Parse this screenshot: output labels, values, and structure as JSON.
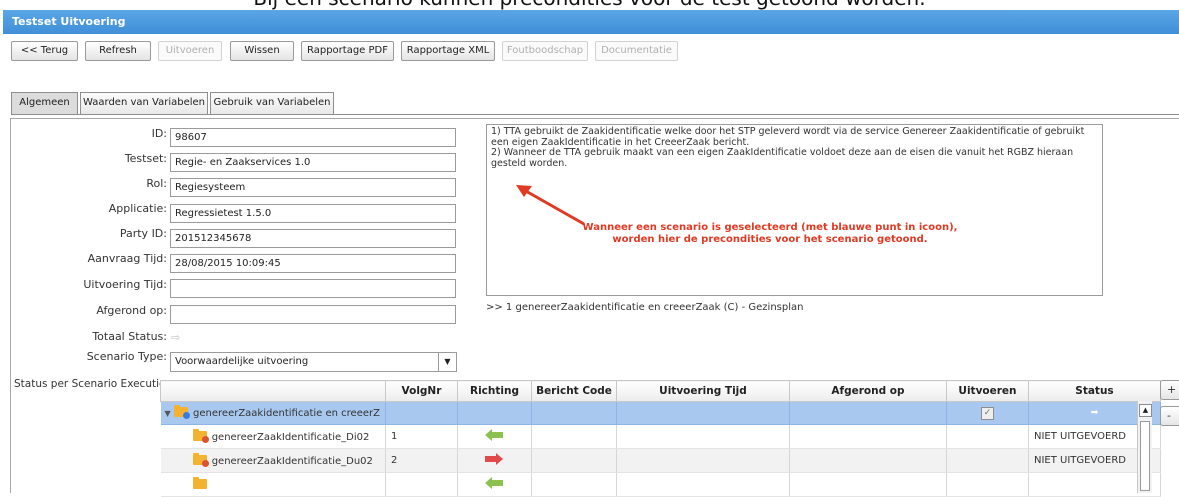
{
  "caption": "Bij een scenario kunnen precondities voor de test getoond worden.",
  "window": {
    "title": "Testset Uitvoering"
  },
  "toolbar": [
    {
      "label": "<< Terug",
      "enabled": true
    },
    {
      "label": "Refresh",
      "enabled": true
    },
    {
      "label": "Uitvoeren",
      "enabled": false
    },
    {
      "label": "Wissen",
      "enabled": true
    },
    {
      "label": "Rapportage PDF",
      "enabled": true
    },
    {
      "label": "Rapportage XML",
      "enabled": true
    },
    {
      "label": "Foutboodschap",
      "enabled": false
    },
    {
      "label": "Documentatie",
      "enabled": false
    }
  ],
  "tabs": [
    {
      "label": "Algemeen",
      "active": true
    },
    {
      "label": "Waarden van Variabelen",
      "active": false
    },
    {
      "label": "Gebruik van Variabelen",
      "active": false
    }
  ],
  "form": {
    "id": {
      "label": "ID:",
      "value": "98607"
    },
    "testset": {
      "label": "Testset:",
      "value": "Regie- en Zaakservices 1.0"
    },
    "rol": {
      "label": "Rol:",
      "value": "Regiesysteem"
    },
    "applicatie": {
      "label": "Applicatie:",
      "value": "Regressietest 1.5.0"
    },
    "party_id": {
      "label": "Party ID:",
      "value": "201512345678"
    },
    "aanvraag_tijd": {
      "label": "Aanvraag Tijd:",
      "value": "28/08/2015 10:09:45"
    },
    "uitvoering_tijd": {
      "label": "Uitvoering Tijd:",
      "value": ""
    },
    "afgerond_op": {
      "label": "Afgerond op:",
      "value": ""
    },
    "totaal_status": {
      "label": "Totaal Status:",
      "icon": "arrow-right-outline-icon"
    },
    "scenario_type": {
      "label": "Scenario Type:",
      "value": "Voorwaardelijke uitvoering"
    },
    "status_per_scenario": {
      "label": "Status per Scenario Executie:"
    }
  },
  "preconditions": {
    "line1": "1) TTA gebruikt de Zaakidentificatie welke door het STP geleverd wordt via de service Genereer Zaakidentificatie of gebruikt een eigen ZaakIdentificatie in het CreeerZaak bericht.",
    "line2": "2) Wanneer de TTA gebruik maakt van een eigen ZaakIdentificatie voldoet deze aan de eisen die vanuit het RGBZ hieraan gesteld worden."
  },
  "annotation": {
    "line1": "Wanneer een scenario is geselecteerd (met blauwe punt in icoon),",
    "line2": "worden hier de precondities voor het scenario getoond."
  },
  "selected_scenario": ">> 1 genereerZaakidentificatie en creeerZaak (C) - Gezinsplan",
  "grid": {
    "columns": [
      "",
      "VolgNr",
      "Richting",
      "Bericht Code",
      "Uitvoering Tijd",
      "Afgerond op",
      "Uitvoeren",
      "Status"
    ],
    "group": {
      "name": "genereerZaakidentificatie en creeerZ",
      "uitvoeren": true
    },
    "rows": [
      {
        "name": "genereerZaakIdentificatie_Di02",
        "volgnr": "1",
        "richting": "inbound",
        "status": "NIET UITGEVOERD"
      },
      {
        "name": "genereerZaakIdentificatie_Du02",
        "volgnr": "2",
        "richting": "outbound",
        "status": "NIET UITGEVOERD"
      }
    ]
  },
  "side_buttons": [
    "+",
    "-"
  ],
  "colors": {
    "accent": "#4596dc",
    "annotation": "#e03a24",
    "group_row": "#a9c8f0",
    "inbound_arrow": "#8cc151",
    "outbound_arrow": "#e04a4a"
  }
}
